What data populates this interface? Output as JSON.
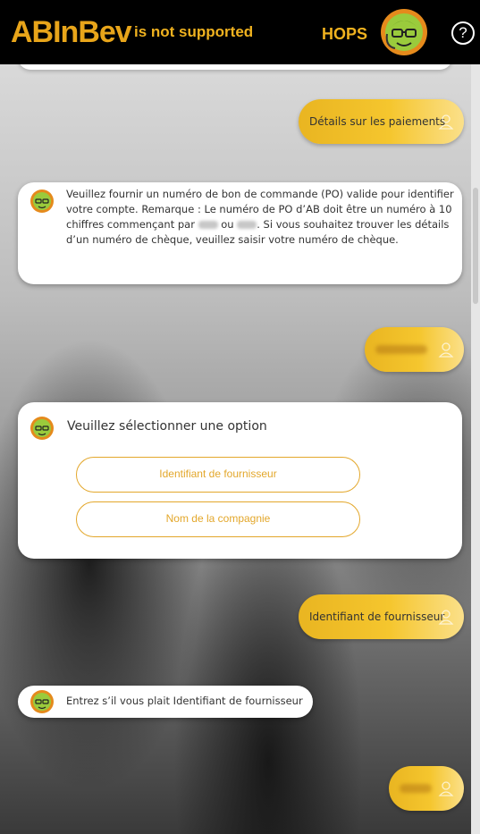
{
  "header": {
    "logo_text": "ABInBev",
    "overlay_text": "is not supported",
    "bot_name": "HOPS",
    "help_label": "?"
  },
  "chat": {
    "messages": [
      {
        "type": "user",
        "text": "Détails sur les paiements"
      },
      {
        "type": "bot",
        "text_part1": "Veuillez fournir un numéro de bon de commande (PO) valide pour identifier votre compte. Remarque : Le numéro de PO d’AB doit être un numéro à 10 chiffres commençant par",
        "text_or": "ou",
        "text_part2": ". Si vous souhaitez trouver les détails d’un numéro de chèque, veuillez saisir votre numéro de chèque."
      },
      {
        "type": "user",
        "text_hidden": true
      },
      {
        "type": "bot-options",
        "prompt": "Veuillez sélectionner une option",
        "options": [
          "Identifiant de fournisseur",
          "Nom de la compagnie"
        ]
      },
      {
        "type": "user",
        "text": "Identifiant de fournisseur"
      },
      {
        "type": "bot",
        "text": "Entrez s’il vous plait Identifiant de fournisseur"
      },
      {
        "type": "user",
        "text_hidden": true
      }
    ]
  },
  "colors": {
    "accent": "#e3a72b",
    "header_bg": "#000000",
    "logo": "#e8a51a",
    "bubble": "#f5c62e"
  }
}
